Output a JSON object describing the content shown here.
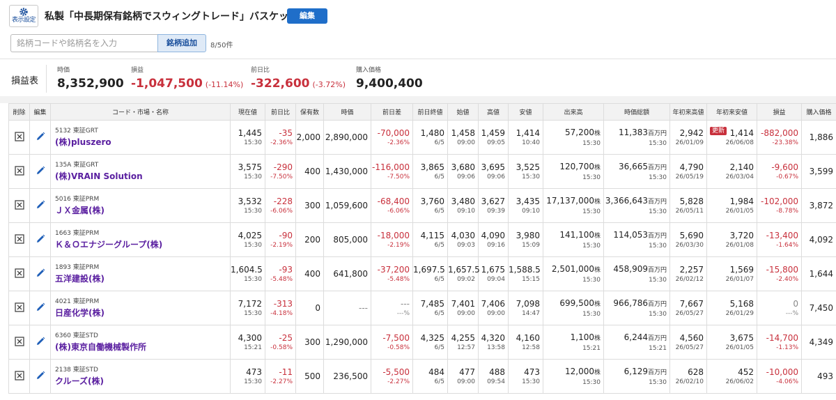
{
  "header": {
    "settings_label": "表示設定",
    "title": "私製「中長期保有銘柄でスウィングトレード」バスケット",
    "edit_label": "編集",
    "search_placeholder": "銘柄コードや銘柄名を入力",
    "add_label": "銘柄追加",
    "count": "8/50件"
  },
  "summary": {
    "label": "損益表",
    "market_value_caption": "時価",
    "market_value": "8,352,900",
    "pnl_caption": "損益",
    "pnl": "-1,047,500",
    "pnl_pct": "(-11.14%)",
    "day_change_caption": "前日比",
    "day_change": "-322,600",
    "day_change_pct": "(-3.72%)",
    "cost_caption": "購入価格",
    "cost": "9,400,400"
  },
  "columns": [
    "削除",
    "編集",
    "コード・市場・名称",
    "現在値",
    "前日比",
    "保有数",
    "時価",
    "前日差",
    "前日終値",
    "始値",
    "高値",
    "安値",
    "出来高",
    "時価総額",
    "年初来高値",
    "年初来安値",
    "損益",
    "購入価格"
  ],
  "units": {
    "shares": "株",
    "million_yen": "百万円"
  },
  "update_badge": "更新",
  "rows": [
    {
      "code": "5132 東証GRT",
      "name": "(株)pluszero",
      "price": "1,445",
      "price_time": "15:30",
      "chg": "-35",
      "chg_pct": "-2.36%",
      "qty": "2,000",
      "mv": "2,890,000",
      "diff": "-70,000",
      "diff_pct": "-2.36%",
      "prev": "1,480",
      "prev_date": "6/5",
      "open": "1,458",
      "open_time": "09:00",
      "high": "1,459",
      "high_time": "09:05",
      "low": "1,414",
      "low_time": "10:40",
      "vol": "57,200",
      "vol_time": "15:30",
      "cap": "11,383",
      "cap_time": "15:30",
      "yh": "2,942",
      "yh_date": "26/01/09",
      "yl": "1,414",
      "yl_date": "26/06/08",
      "yl_new": true,
      "pnl": "-882,000",
      "pnl_pct": "-23.38%",
      "cost": "1,886",
      "pnl_zero": false
    },
    {
      "code": "135A 東証GRT",
      "name": "(株)VRAIN Solution",
      "price": "3,575",
      "price_time": "15:30",
      "chg": "-290",
      "chg_pct": "-7.50%",
      "qty": "400",
      "mv": "1,430,000",
      "diff": "-116,000",
      "diff_pct": "-7.50%",
      "prev": "3,865",
      "prev_date": "6/5",
      "open": "3,680",
      "open_time": "09:06",
      "high": "3,695",
      "high_time": "09:06",
      "low": "3,525",
      "low_time": "15:30",
      "vol": "120,700",
      "vol_time": "15:30",
      "cap": "36,665",
      "cap_time": "15:30",
      "yh": "4,790",
      "yh_date": "26/05/19",
      "yl": "2,140",
      "yl_date": "26/03/04",
      "yl_new": false,
      "pnl": "-9,600",
      "pnl_pct": "-0.67%",
      "cost": "3,599",
      "pnl_zero": false
    },
    {
      "code": "5016 東証PRM",
      "name": "ＪＸ金属(株)",
      "price": "3,532",
      "price_time": "15:30",
      "chg": "-228",
      "chg_pct": "-6.06%",
      "qty": "300",
      "mv": "1,059,600",
      "diff": "-68,400",
      "diff_pct": "-6.06%",
      "prev": "3,760",
      "prev_date": "6/5",
      "open": "3,480",
      "open_time": "09:10",
      "high": "3,627",
      "high_time": "09:39",
      "low": "3,435",
      "low_time": "09:10",
      "vol": "17,137,000",
      "vol_time": "15:30",
      "cap": "3,366,643",
      "cap_time": "15:30",
      "yh": "5,828",
      "yh_date": "26/05/11",
      "yl": "1,984",
      "yl_date": "26/01/05",
      "yl_new": false,
      "pnl": "-102,000",
      "pnl_pct": "-8.78%",
      "cost": "3,872",
      "pnl_zero": false
    },
    {
      "code": "1663 東証PRM",
      "name": "Ｋ＆Ｏエナジーグループ(株)",
      "price": "4,025",
      "price_time": "15:30",
      "chg": "-90",
      "chg_pct": "-2.19%",
      "qty": "200",
      "mv": "805,000",
      "diff": "-18,000",
      "diff_pct": "-2.19%",
      "prev": "4,115",
      "prev_date": "6/5",
      "open": "4,030",
      "open_time": "09:03",
      "high": "4,090",
      "high_time": "09:16",
      "low": "3,980",
      "low_time": "15:09",
      "vol": "141,100",
      "vol_time": "15:30",
      "cap": "114,053",
      "cap_time": "15:30",
      "yh": "5,690",
      "yh_date": "26/03/30",
      "yl": "3,720",
      "yl_date": "26/01/08",
      "yl_new": false,
      "pnl": "-13,400",
      "pnl_pct": "-1.64%",
      "cost": "4,092",
      "pnl_zero": false
    },
    {
      "code": "1893 東証PRM",
      "name": "五洋建設(株)",
      "price": "1,604.5",
      "price_time": "15:30",
      "chg": "-93",
      "chg_pct": "-5.48%",
      "qty": "400",
      "mv": "641,800",
      "diff": "-37,200",
      "diff_pct": "-5.48%",
      "prev": "1,697.5",
      "prev_date": "6/5",
      "open": "1,657.5",
      "open_time": "09:02",
      "high": "1,675",
      "high_time": "09:04",
      "low": "1,588.5",
      "low_time": "15:15",
      "vol": "2,501,000",
      "vol_time": "15:30",
      "cap": "458,909",
      "cap_time": "15:30",
      "yh": "2,257",
      "yh_date": "26/02/12",
      "yl": "1,569",
      "yl_date": "26/01/07",
      "yl_new": false,
      "pnl": "-15,800",
      "pnl_pct": "-2.40%",
      "cost": "1,644",
      "pnl_zero": false
    },
    {
      "code": "4021 東証PRM",
      "name": "日産化学(株)",
      "price": "7,172",
      "price_time": "15:30",
      "chg": "-313",
      "chg_pct": "-4.18%",
      "qty": "0",
      "mv": "---",
      "diff": "---",
      "diff_pct": "---%",
      "prev": "7,485",
      "prev_date": "6/5",
      "open": "7,401",
      "open_time": "09:00",
      "high": "7,406",
      "high_time": "09:00",
      "low": "7,098",
      "low_time": "14:47",
      "vol": "699,500",
      "vol_time": "15:30",
      "cap": "966,786",
      "cap_time": "15:30",
      "yh": "7,667",
      "yh_date": "26/05/27",
      "yl": "5,168",
      "yl_date": "26/01/29",
      "yl_new": false,
      "pnl": "0",
      "pnl_pct": "---%",
      "cost": "7,450",
      "pnl_zero": true
    },
    {
      "code": "6360 東証STD",
      "name": "(株)東京自働機械製作所",
      "price": "4,300",
      "price_time": "15:21",
      "chg": "-25",
      "chg_pct": "-0.58%",
      "qty": "300",
      "mv": "1,290,000",
      "diff": "-7,500",
      "diff_pct": "-0.58%",
      "prev": "4,325",
      "prev_date": "6/5",
      "open": "4,255",
      "open_time": "12:57",
      "high": "4,320",
      "high_time": "13:58",
      "low": "4,160",
      "low_time": "12:58",
      "vol": "1,100",
      "vol_time": "15:21",
      "cap": "6,244",
      "cap_time": "15:21",
      "yh": "4,560",
      "yh_date": "26/05/27",
      "yl": "3,675",
      "yl_date": "26/01/05",
      "yl_new": false,
      "pnl": "-14,700",
      "pnl_pct": "-1.13%",
      "cost": "4,349",
      "pnl_zero": false
    },
    {
      "code": "2138 東証STD",
      "name": "クルーズ(株)",
      "price": "473",
      "price_time": "15:30",
      "chg": "-11",
      "chg_pct": "-2.27%",
      "qty": "500",
      "mv": "236,500",
      "diff": "-5,500",
      "diff_pct": "-2.27%",
      "prev": "484",
      "prev_date": "6/5",
      "open": "477",
      "open_time": "09:00",
      "high": "488",
      "high_time": "09:54",
      "low": "473",
      "low_time": "15:30",
      "vol": "12,000",
      "vol_time": "15:30",
      "cap": "6,129",
      "cap_time": "15:30",
      "yh": "628",
      "yh_date": "26/02/10",
      "yl": "452",
      "yl_date": "26/06/02",
      "yl_new": false,
      "pnl": "-10,000",
      "pnl_pct": "-4.06%",
      "cost": "493",
      "pnl_zero": false
    }
  ]
}
